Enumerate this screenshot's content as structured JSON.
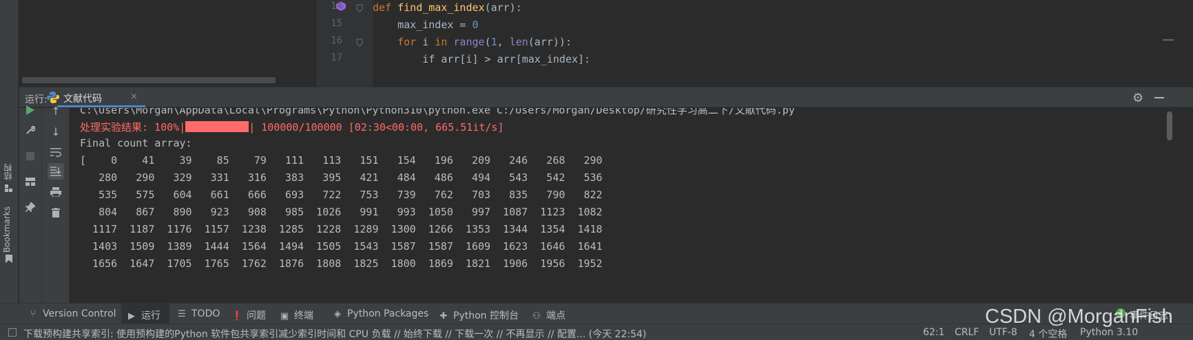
{
  "left_strip": {
    "structure_label": "结构",
    "bookmarks_label": "Bookmarks"
  },
  "editor": {
    "line_numbers": [
      "14",
      "15",
      "16",
      "17"
    ],
    "lines": {
      "l14": {
        "kw": "def",
        "fn": "find_max_index",
        "rest": "(arr):"
      },
      "l15": {
        "text": "    max_index = ",
        "num": "0"
      },
      "l16": {
        "indent": "    ",
        "kw1": "for",
        "mid1": " i ",
        "kw2": "in",
        "sp": " ",
        "bi1": "range",
        "p1": "(",
        "num": "1",
        "p2": ", ",
        "bi2": "len",
        "rest": "(arr)):"
      },
      "l17": {
        "text": "        if arr[i] > arr[max_index]:"
      }
    }
  },
  "run_window": {
    "label": "运行:",
    "tab_label": "文献代码",
    "tab_close": "×",
    "gear_icon": "gear-icon",
    "minimize_icon": "minimize-icon"
  },
  "console": {
    "command": "C:\\Users\\Morgan\\AppData\\Local\\Programs\\Python\\Python310\\python.exe C:/Users/Morgan/Desktop/研究性学习高二下/文献代码.py",
    "progress_prefix": "处理实验结果: 100%|",
    "progress_fraction": 1.0,
    "progress_suffix": "| 100000/100000 [02:30<00:00, 665.51it/s]",
    "final_label": "Final count array:",
    "array_rows": [
      "[    0    41    39    85    79   111   113   151   154   196   209   246   268   290",
      "   280   290   329   331   316   383   395   421   484   486   494   543   542   536",
      "   535   575   604   661   666   693   722   753   739   762   703   835   790   822",
      "   804   867   890   923   908   985  1026   991   993  1050   997  1087  1123  1082",
      "  1117  1187  1176  1157  1238  1285  1228  1289  1300  1266  1353  1344  1354  1418",
      "  1403  1509  1389  1444  1564  1494  1505  1543  1587  1587  1609  1623  1646  1641",
      "  1656  1647  1705  1765  1762  1876  1808  1825  1800  1869  1821  1906  1956  1952"
    ]
  },
  "tool_tabs": {
    "version_control": "Version Control",
    "run": "运行",
    "todo": "TODO",
    "problems": "问题",
    "terminal": "终端",
    "python_packages": "Python Packages",
    "python_console": "Python 控制台",
    "endpoints": "端点",
    "event_log": "事件日志",
    "event_count": "3"
  },
  "status_bar": {
    "message": "下载预构建共享索引: 使用预构建的Python 软件包共享索引减少索引时间和 CPU 负载 // 始终下载 // 下载一次 // 不再显示 // 配置... (今天 22:54)",
    "position": "62:1",
    "line_sep": "CRLF",
    "encoding": "UTF-8",
    "indent": "4 个空格",
    "interpreter": "Python 3.10"
  },
  "watermark": "CSDN @MorganFish",
  "colors": {
    "accent": "#4a88c7",
    "error_red": "#ff6b68",
    "background": "#2b2b2b",
    "panel": "#3c3f41"
  }
}
